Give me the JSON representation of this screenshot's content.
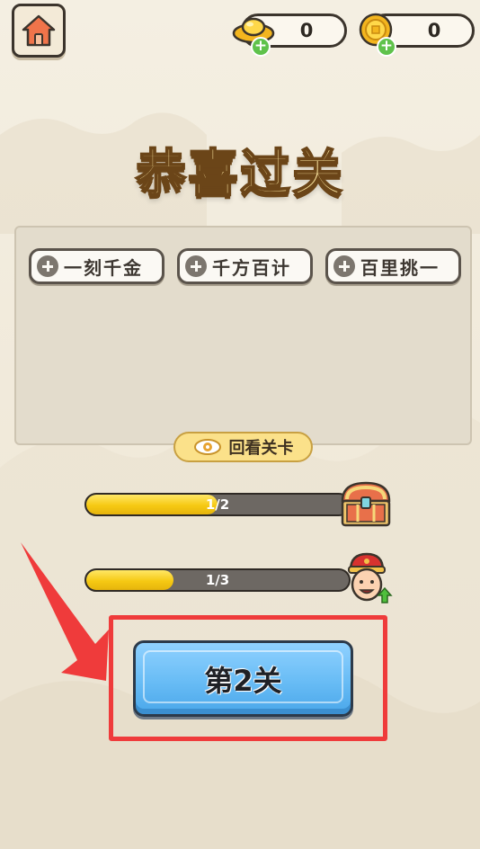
{
  "header": {
    "home_icon": "home-icon",
    "ingot": {
      "icon": "gold-ingot-icon",
      "amount": "0"
    },
    "coin": {
      "icon": "gold-coin-icon",
      "amount": "0"
    }
  },
  "title": "恭喜过关",
  "idioms": [
    {
      "text": "一刻千金"
    },
    {
      "text": "千方百计"
    },
    {
      "text": "百里挑一"
    }
  ],
  "review_button": {
    "label": "回看关卡",
    "icon": "eye-icon"
  },
  "progress": [
    {
      "label": "1/2",
      "current": 1,
      "total": 2,
      "icon": "treasure-chest-icon"
    },
    {
      "label": "1/3",
      "current": 1,
      "total": 3,
      "icon": "official-avatar-icon"
    }
  ],
  "level_button": {
    "label": "第2关"
  },
  "colors": {
    "highlight": "#ef3b3b",
    "arrow": "#ef3b3b",
    "level_button": "#68bcf5",
    "progress_fill": "#f6c913",
    "review_button": "#fbe18a"
  }
}
